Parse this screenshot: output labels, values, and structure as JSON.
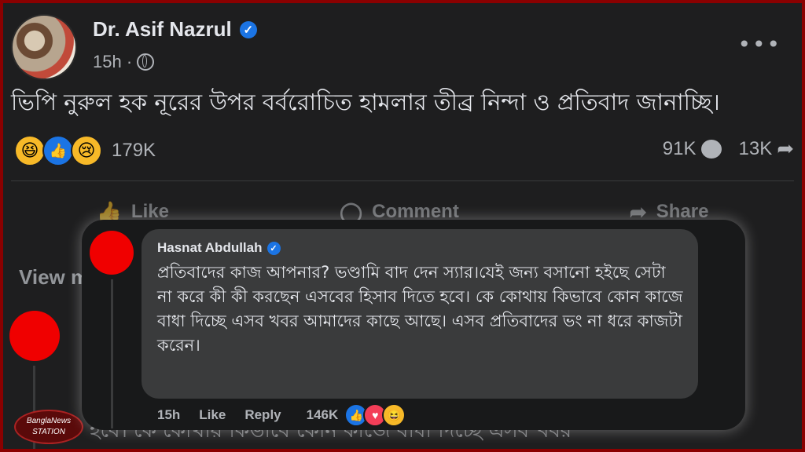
{
  "post": {
    "author": "Dr. Asif Nazrul",
    "time": "15h ·",
    "text": "ভিপি নুরুল হক নূরের উপর বর্বরোচিত হামলার তীব্র নিন্দা ও প্রতিবাদ জানাচ্ছি।",
    "reaction_count": "179K",
    "comment_count": "91K",
    "share_count": "13K",
    "more_label": "•••"
  },
  "actions": {
    "like": "Like",
    "comment": "Comment",
    "share": "Share"
  },
  "view_more": "View m",
  "background_text": "হবে। কে কোথায় কিভাবে কোন কাজে বাধা দিচ্ছে এসব খবর",
  "watermark": {
    "line1": "BanglaNews",
    "line2": "STATION"
  },
  "comment": {
    "author": "Hasnat Abdullah",
    "text": "প্রতিবাদের কাজ আপনার? ভণ্ডামি বাদ দেন স্যার।যেই জন্য বসানো হইছে সেটা না করে কী কী করছেন এসবের হিসাব দিতে হবে। কে কোথায় কিভাবে কোন কাজে বাধা দিচ্ছে এসব খবর আমাদের কাছে আছে। এসব প্রতিবাদের ভং না ধরে কাজটা করেন।",
    "time": "15h",
    "like": "Like",
    "reply": "Reply",
    "reaction_count": "146K"
  },
  "colors": {
    "frame": "#8a0000",
    "background": "#1e1e1f",
    "bubble": "#3a3b3c",
    "verified": "#1b74e4",
    "avatar_red": "#f00000"
  },
  "icons": [
    "verified-icon",
    "globe-icon",
    "more-icon",
    "haha-icon",
    "like-icon",
    "sad-icon",
    "love-icon",
    "comment-icon",
    "share-icon",
    "like-action-icon",
    "comment-action-icon",
    "share-action-icon"
  ]
}
